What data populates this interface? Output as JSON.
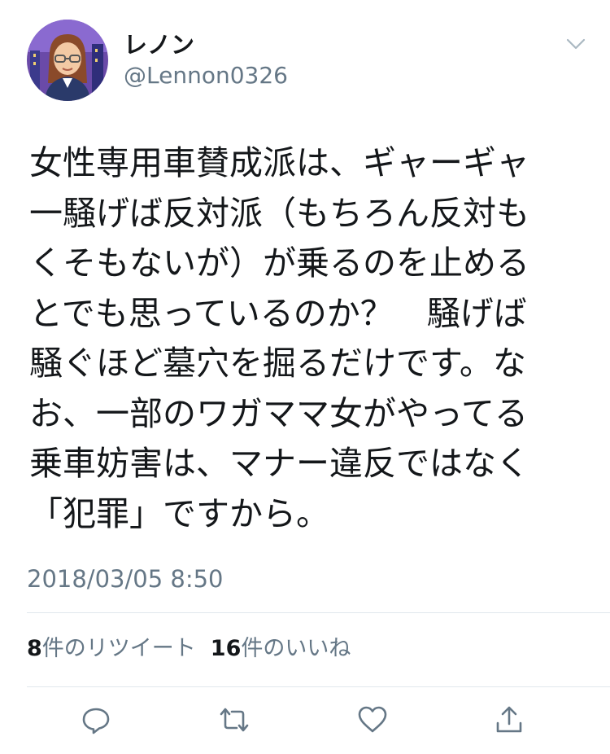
{
  "user": {
    "display_name": "レノン",
    "handle": "@Lennon0326"
  },
  "tweet": {
    "text": "女性専用車賛成派は、ギャーギャ\n一騒げば反対派（もちろん反対も\nくそもないが）が乗るのを止める\nとでも思っているのか？　騒げば\n騒ぐほど墓穴を掘るだけです。な\nお、一部のワガママ女がやってる\n乗車妨害は、マナー違反ではなく\n「犯罪」ですから。",
    "timestamp": "2018/03/05 8:50"
  },
  "stats": {
    "retweets_count": "8",
    "retweets_label": "件のリツイート",
    "likes_count": "16",
    "likes_label": "件のいいね"
  },
  "actions": [
    "reply-icon",
    "retweet-icon",
    "like-icon",
    "share-icon"
  ],
  "colors": {
    "text": "#14171a",
    "secondary": "#657786",
    "divider": "#e1e8ed"
  }
}
